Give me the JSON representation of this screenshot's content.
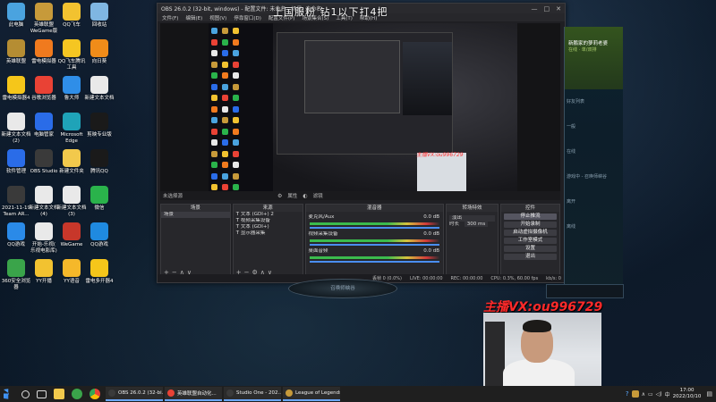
{
  "desktop_icons": [
    {
      "label": "此电脑",
      "color": "#4aa3df"
    },
    {
      "label": "英雄联盟\nWeGame版",
      "color": "#c79a3a"
    },
    {
      "label": "QQ飞车",
      "color": "#f2c230"
    },
    {
      "label": "回收站",
      "color": "#7fb6e2"
    },
    {
      "label": "英雄联盟",
      "color": "#b58d33"
    },
    {
      "label": "雷电模拟器",
      "color": "#f07a1e"
    },
    {
      "label": "QQ飞车腾讯\n工具",
      "color": "#f5c622"
    },
    {
      "label": "向日葵",
      "color": "#f08c19"
    },
    {
      "label": "雷电模拟器4",
      "color": "#f5c61a"
    },
    {
      "label": "谷歌浏览器",
      "color": "#e94235"
    },
    {
      "label": "鲁大师",
      "color": "#2f8ee8"
    },
    {
      "label": "新建文本文档",
      "color": "#e9e9e9"
    },
    {
      "label": "新建文本文档\n(2)",
      "color": "#e9e9e9"
    },
    {
      "label": "电脑管家",
      "color": "#2a6ce8"
    },
    {
      "label": "Microsoft\nEdge",
      "color": "#1fa3b8"
    },
    {
      "label": "剪映专业版",
      "color": "#1a1a1a"
    },
    {
      "label": "软件管理",
      "color": "#2a6ce8"
    },
    {
      "label": "OBS Studio",
      "color": "#3a3a3a"
    },
    {
      "label": "新建文件夹",
      "color": "#f2c94c"
    },
    {
      "label": "腾讯QQ",
      "color": "#1a1a1a"
    },
    {
      "label": "2021-11-19\nTeam AR...",
      "color": "#3a3a3a"
    },
    {
      "label": "新建文本文档\n(4)",
      "color": "#e9e9e9"
    },
    {
      "label": "新建文本文档\n(3)",
      "color": "#e9e9e9"
    },
    {
      "label": "微信",
      "color": "#2ab34b"
    },
    {
      "label": "QQ游戏",
      "color": "#2a8ae8"
    },
    {
      "label": "开始-乐视(\n乐视电影库)",
      "color": "#e9e9e9"
    },
    {
      "label": "WeGame",
      "color": "#c7372a"
    },
    {
      "label": "QQ游戏",
      "color": "#1f8ae0"
    },
    {
      "label": "360安全浏览\n器",
      "color": "#3aa44a"
    },
    {
      "label": "YY开播",
      "color": "#f2c230"
    },
    {
      "label": "YY语音",
      "color": "#f5b82a"
    },
    {
      "label": "雷电多开器4",
      "color": "#f5c61a"
    }
  ],
  "obs": {
    "title": "OBS 26.0.2 (32-bit, windows) - 配置文件: 未命名 - 场景: 未命名",
    "menus": [
      "文件(F)",
      "编辑(E)",
      "视图(V)",
      "停靠窗口(D)",
      "配置文件(P)",
      "场景集合(S)",
      "工具(T)",
      "帮助(H)"
    ],
    "no_source": "未选择源",
    "properties_btn": "属性",
    "filters_btn": "滤镜",
    "docks": {
      "scenes": {
        "title": "场景",
        "items": [
          "场景"
        ]
      },
      "sources": {
        "title": "来源",
        "items": [
          "文本 (GDI+) 2",
          "视频采集设备",
          "文本 (GDI+)",
          "显示器采集"
        ]
      },
      "mixer": {
        "title": "混音器",
        "tracks": [
          {
            "name": "麦克风/Aux",
            "db": "0.0 dB"
          },
          {
            "name": "视频采集设备",
            "db": "0.0 dB"
          },
          {
            "name": "桌面音频",
            "db": "0.0 dB"
          }
        ]
      },
      "transitions": {
        "title": "转场特效",
        "type": "淡出",
        "duration_label": "时长",
        "duration": "300 ms"
      },
      "controls": {
        "title": "控件",
        "buttons": [
          "停止推流",
          "开始录制",
          "启动虚拟摄像机",
          "工作室模式",
          "设置",
          "退出"
        ]
      }
    },
    "status": {
      "dropped": "丢帧 0 (0.0%)",
      "live": "LIVE: 00:00:00",
      "rec": "REC: 00:00:00",
      "cpu": "CPU: 0.3%, 60.00 fps",
      "kbps": "kb/s: 0"
    }
  },
  "overlay": {
    "banner": "上国服粉 钻1以下打4把",
    "banner_echo": "上国服粉 钻1以下打4把",
    "vx_small": "主播VX:ou996729",
    "vx_big": "主播VX:ou996729"
  },
  "lol": {
    "profile_name": "新鹏家的萝莉老婆",
    "profile_status": "在线 · 单/双排",
    "lines": [
      "好友列表",
      "一般",
      "在线",
      "游戏中 - 召唤师峡谷",
      "离开",
      "离线"
    ],
    "stage_label": "召唤师峡谷"
  },
  "taskbar": {
    "apps": [
      {
        "label": "OBS 26.0.2 (32-bi...",
        "color": "#3a3a3a"
      },
      {
        "label": "英雄联盟自动化...",
        "color": "#e94235"
      },
      {
        "label": "Studio One - 202...",
        "color": "#3a3a3a"
      },
      {
        "label": "League of Legends",
        "color": "#c79a3a"
      }
    ],
    "time": "17:00",
    "date": "2022/10/10"
  }
}
